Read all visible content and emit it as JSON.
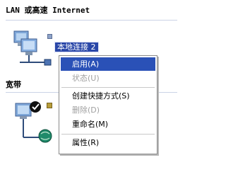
{
  "groups": {
    "lan": {
      "header": "LAN 或高速 Internet"
    },
    "broadband": {
      "header": "宽带"
    }
  },
  "connection": {
    "name": "本地连接 2"
  },
  "menu": {
    "items": [
      {
        "label": "启用(A)"
      },
      {
        "label": "状态(U)"
      },
      {
        "label": "创建快捷方式(S)"
      },
      {
        "label": "删除(D)"
      },
      {
        "label": "重命名(M)"
      },
      {
        "label": "属性(R)"
      }
    ]
  },
  "colors": {
    "selection": "#2a51b7",
    "header_line": "#cbd3e6",
    "disabled_text": "#a0a0a0"
  },
  "icons": {
    "lan_connection": "network-computers-icon",
    "broadband_connection": "globe-computer-icon"
  }
}
